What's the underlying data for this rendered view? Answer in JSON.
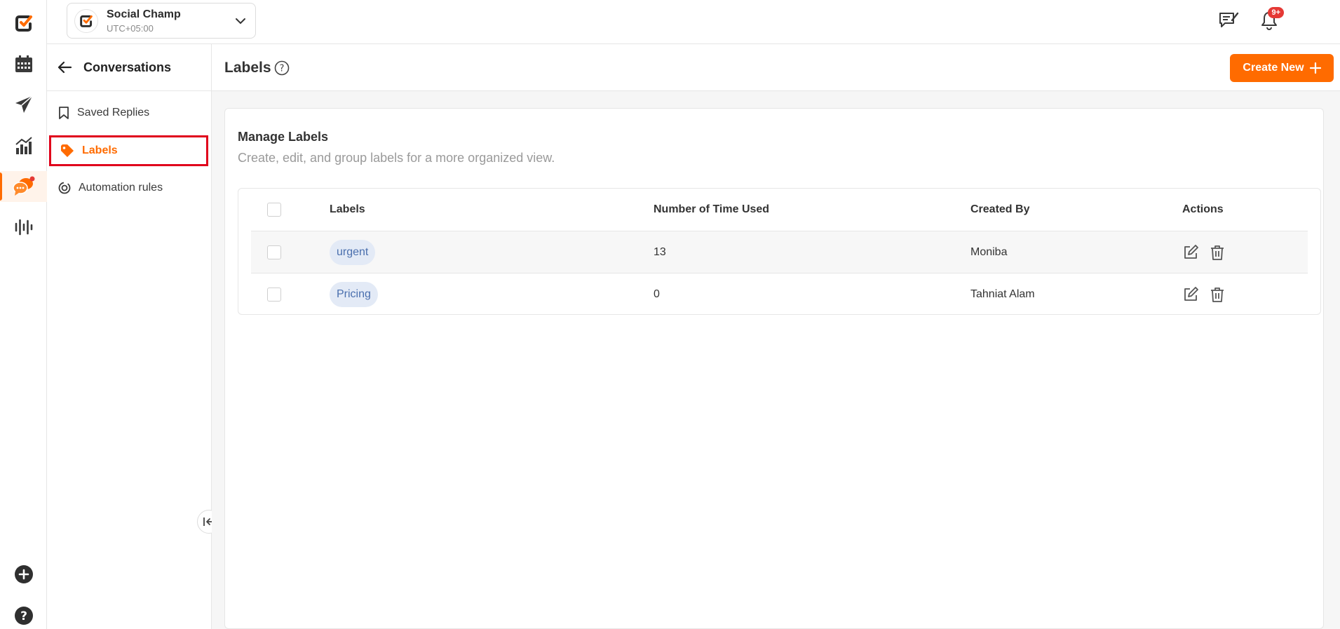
{
  "workspace": {
    "name": "Social Champ",
    "timezone": "UTC+05:00"
  },
  "topbar": {
    "notifications_badge": "9+"
  },
  "subnav": {
    "title": "Conversations",
    "items": [
      {
        "label": "Saved Replies",
        "icon": "bookmark-icon"
      },
      {
        "label": "Labels",
        "icon": "tag-icon",
        "active": true
      },
      {
        "label": "Automation rules",
        "icon": "automation-icon"
      }
    ]
  },
  "page": {
    "title": "Labels",
    "create_label": "Create New"
  },
  "manage": {
    "title": "Manage Labels",
    "subtitle": "Create, edit, and group labels for a more organized view."
  },
  "table": {
    "columns": [
      "Labels",
      "Number of Time Used",
      "Created By",
      "Actions"
    ],
    "rows": [
      {
        "label": "urgent",
        "used": "13",
        "created_by": "Moniba"
      },
      {
        "label": "Pricing",
        "used": "0",
        "created_by": "Tahniat Alam"
      }
    ]
  },
  "colors": {
    "accent": "#ff6b00",
    "chip_bg": "#e3eaf6",
    "chip_text": "#4a6fae",
    "highlight": "#e0001b"
  }
}
